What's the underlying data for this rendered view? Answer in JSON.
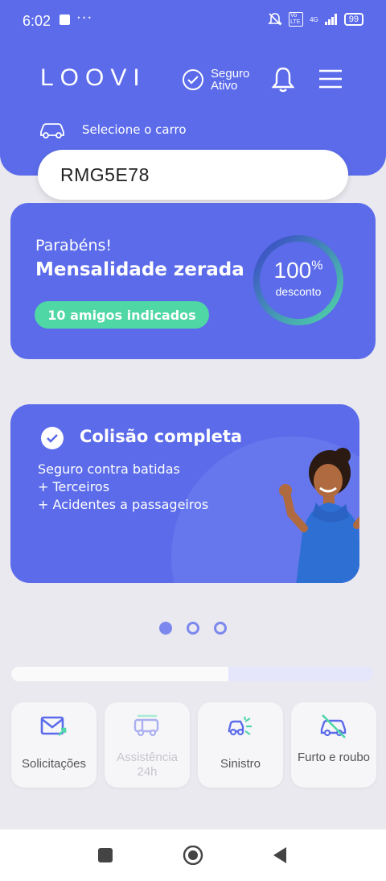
{
  "status": {
    "time": "6:02",
    "dots": "···",
    "battery": "99",
    "network": "4G",
    "volte": "Vo LTE"
  },
  "header": {
    "logo": "LOOVI",
    "seguro_line1": "Seguro",
    "seguro_line2": "Ativo",
    "select_label": "Selecione o carro",
    "plate": "RMG5E78"
  },
  "discount": {
    "congrats": "Parabéns!",
    "title": "Mensalidade zerada",
    "friends": "10 amigos indicados",
    "percent": "100",
    "percent_sign": "%",
    "percent_label": "desconto",
    "progress_fraction": 1.0
  },
  "coverage": {
    "title": "Colisão completa",
    "lines": [
      "Seguro contra batidas",
      "+ Terceiros",
      "+ Acidentes a passageiros"
    ]
  },
  "carousel": {
    "count": 3,
    "active": 0
  },
  "progress_fraction": 0.6,
  "tiles": [
    {
      "label": "Solicitações",
      "icon": "mail-icon",
      "enabled": true
    },
    {
      "label": "Assistência 24h",
      "icon": "tow-truck-icon",
      "enabled": false
    },
    {
      "label": "Sinistro",
      "icon": "car-crash-icon",
      "enabled": true
    },
    {
      "label": "Furto e roubo",
      "icon": "car-theft-icon",
      "enabled": true
    }
  ],
  "colors": {
    "primary": "#5b6bea",
    "accent": "#4fd7a6",
    "background": "#e9e9ef"
  }
}
